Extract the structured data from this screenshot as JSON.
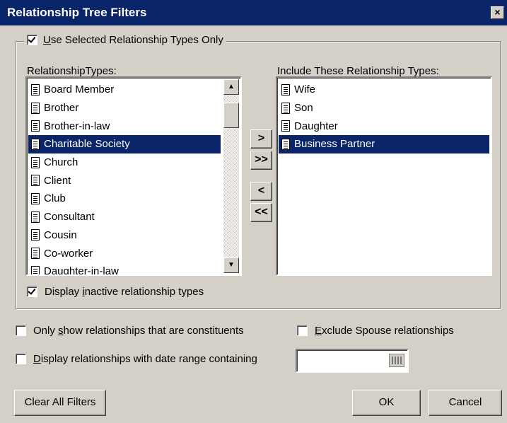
{
  "window": {
    "title": "Relationship Tree Filters",
    "close_glyph": "×"
  },
  "use_selected": {
    "label_prefix": "U",
    "label_rest": "se Selected Relationship Types Only",
    "checked": true
  },
  "left_list": {
    "label": "RelationshipTypes:",
    "items": [
      "Board Member",
      "Brother",
      "Brother-in-law",
      "Charitable Society",
      "Church",
      "Client",
      "Club",
      "Consultant",
      "Cousin",
      "Co-worker",
      "Daughter-in-law"
    ],
    "selected": "Charitable Society"
  },
  "right_list": {
    "label": "Include These Relationship Types:",
    "items": [
      "Wife",
      "Son",
      "Daughter",
      "Business Partner"
    ],
    "selected": "Business Partner"
  },
  "move_buttons": {
    "add": ">",
    "add_all": ">>",
    "remove": "<",
    "remove_all": "<<"
  },
  "display_inactive": {
    "label_a": "Display ",
    "label_u": "i",
    "label_b": "nactive relationship types",
    "checked": true
  },
  "only_constituents": {
    "label_a": "Only ",
    "label_u": "s",
    "label_b": "how relationships that are constituents",
    "checked": false
  },
  "exclude_spouse": {
    "label_u": "E",
    "label_b": "xclude Spouse relationships",
    "checked": false
  },
  "date_range": {
    "label_u": "D",
    "label_b": "isplay relationships with date range containing",
    "checked": false,
    "value": ""
  },
  "footer": {
    "clear": "Clear All Filters",
    "ok": "OK",
    "cancel": "Cancel"
  },
  "colors": {
    "title_bg": "#0a246a",
    "selection_bg": "#0a246a",
    "face": "#d4d0c8"
  }
}
